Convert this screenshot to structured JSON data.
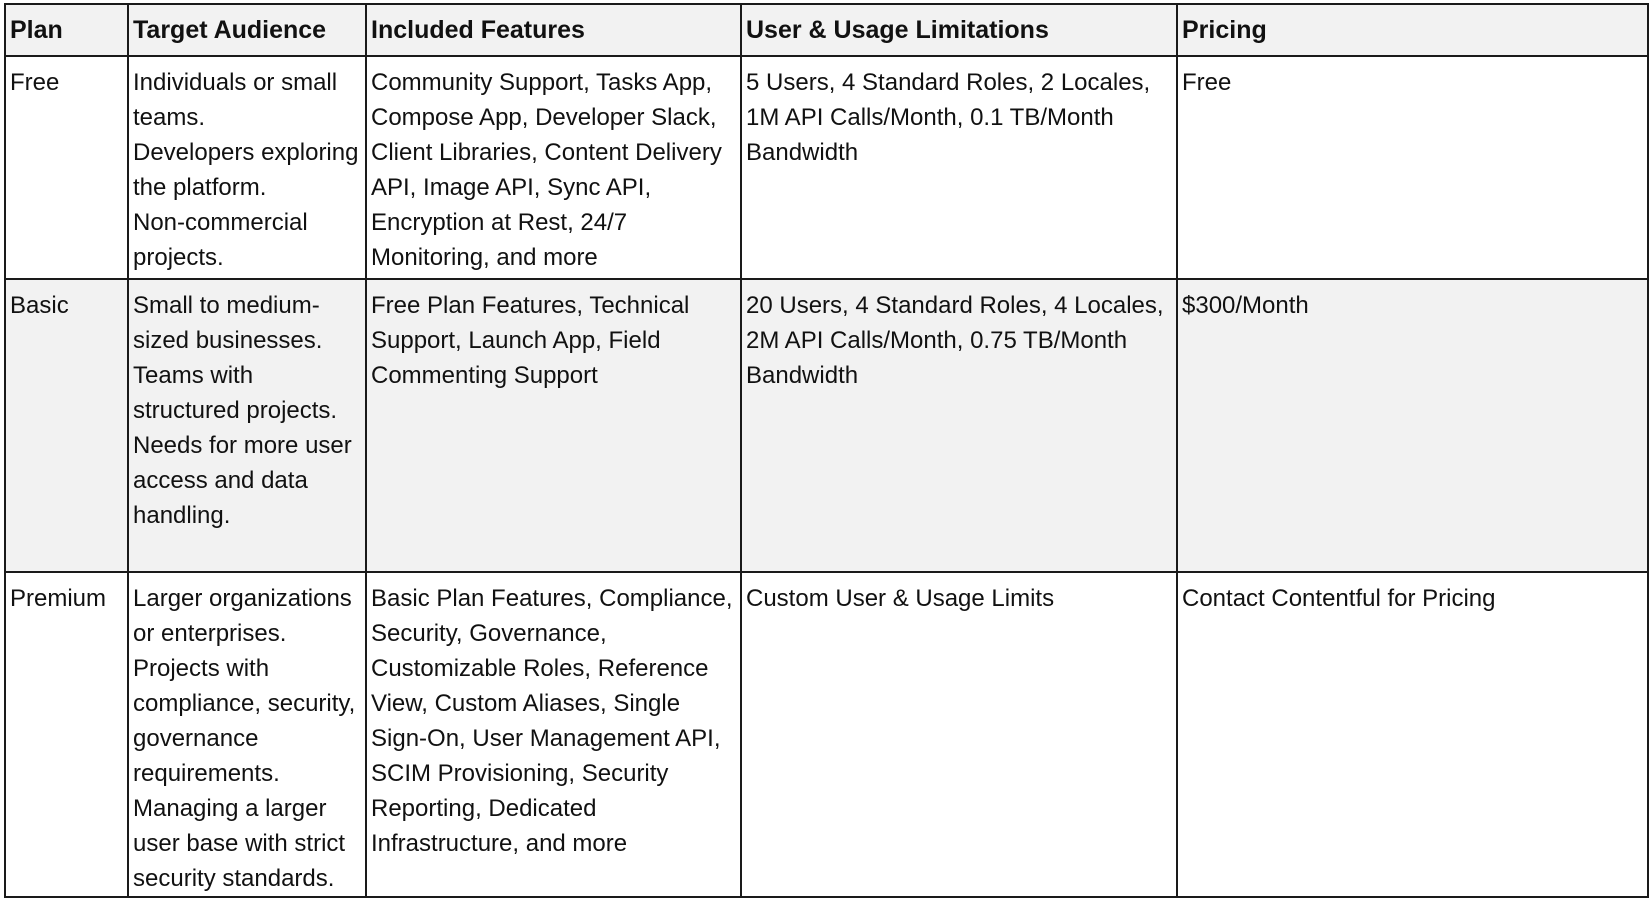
{
  "table": {
    "headers": {
      "plan": "Plan",
      "audience": "Target Audience",
      "features": "Included Features",
      "limits": "User & Usage Limitations",
      "pricing": "Pricing"
    },
    "rows": [
      {
        "plan": "Free",
        "audience": [
          "Individuals or small teams.",
          "Developers exploring the platform.",
          "Non-commercial projects."
        ],
        "features": "Community Support, Tasks App, Compose App, Developer Slack, Client Libraries, Content Delivery API, Image API, Sync API, Encryption at Rest, 24/7 Monitoring, and more",
        "limits": "5 Users, 4 Standard Roles, 2 Locales, 1M API Calls/Month, 0.1 TB/Month Bandwidth",
        "pricing": "Free"
      },
      {
        "plan": "Basic",
        "audience": [
          "Small to medium-sized businesses.",
          "Teams with structured projects.",
          "Needs for more user access and data handling."
        ],
        "features": "Free Plan Features, Technical Support, Launch App, Field Commenting Support",
        "limits": "20 Users, 4 Standard Roles, 4 Locales, 2M API Calls/Month, 0.75 TB/Month Bandwidth",
        "pricing": "$300/Month"
      },
      {
        "plan": "Premium",
        "audience": [
          "Larger organizations or enterprises.",
          "Projects with compliance, security, governance requirements.",
          "Managing a larger user base with strict security standards."
        ],
        "features": "Basic Plan Features, Compliance, Security, Governance, Customizable Roles, Reference View, Custom Aliases, Single Sign-On, User Management API, SCIM Provisioning, Security Reporting, Dedicated Infrastructure, and more",
        "limits": "Custom User & Usage Limits",
        "pricing": "Contact Contentful for Pricing"
      }
    ]
  },
  "colors": {
    "header_bg": "#f2f2f2",
    "alt_row_bg": "#f2f2f2",
    "border": "#1a1a1a",
    "text": "#111111"
  }
}
